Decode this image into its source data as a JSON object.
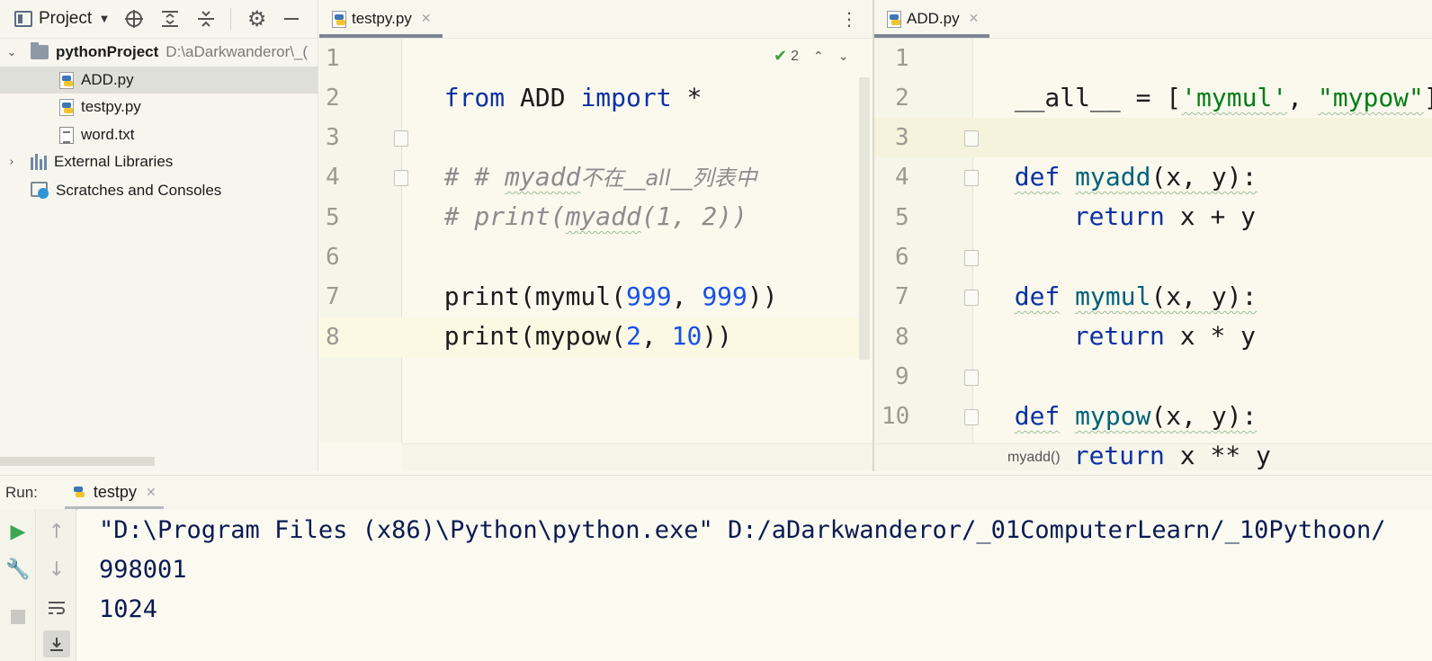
{
  "project": {
    "title": "Project",
    "root_name": "pythonProject",
    "root_path": "D:\\aDarkwanderor\\_(",
    "files": [
      "ADD.py",
      "testpy.py",
      "word.txt"
    ],
    "external_libraries": "External Libraries",
    "scratches": "Scratches and Consoles"
  },
  "editor_left": {
    "tab": "testpy.py",
    "inspection_count": "2",
    "line_numbers": [
      "1",
      "2",
      "3",
      "4",
      "5",
      "6",
      "7",
      "8"
    ],
    "lines": {
      "l1_kw1": "from",
      "l1_mod": " ADD ",
      "l1_kw2": "import",
      "l1_rest": " *",
      "l3_a": "# # ",
      "l3_b": "myadd",
      "l3_c": "不在__all__列表中",
      "l4_a": "# print(",
      "l4_b": "myadd",
      "l4_c": "(1, 2))",
      "l6_a": "print(mymul(",
      "l6_n1": "999",
      "l6_sep": ", ",
      "l6_n2": "999",
      "l6_end": "))",
      "l7_a": "print(mypow(",
      "l7_n1": "2",
      "l7_sep": ", ",
      "l7_n2": "10",
      "l7_end": "))"
    }
  },
  "editor_right": {
    "tab": "ADD.py",
    "line_numbers": [
      "1",
      "2",
      "3",
      "4",
      "5",
      "6",
      "7",
      "8",
      "9",
      "10"
    ],
    "breadcrumb": "myadd()",
    "lines": {
      "l1_a": "__all__ = [",
      "l1_s1": "'mymul'",
      "l1_sep": ", ",
      "l1_s2": "\"mypow\"",
      "l1_end": "]",
      "def": "def",
      "l3_fn": "myadd",
      "l6_fn": "mymul",
      "l9_fn": "mypow",
      "params": "(x, y):",
      "ret": "return",
      "l4_expr": " x + y",
      "l7_expr": " x * y",
      "l10_expr": " x ** y"
    }
  },
  "run": {
    "label": "Run:",
    "tab": "testpy",
    "output": [
      "\"D:\\Program Files (x86)\\Python\\python.exe\" D:/aDarkwanderor/_01ComputerLearn/_10Pythoon/",
      "998001",
      "1024"
    ]
  }
}
